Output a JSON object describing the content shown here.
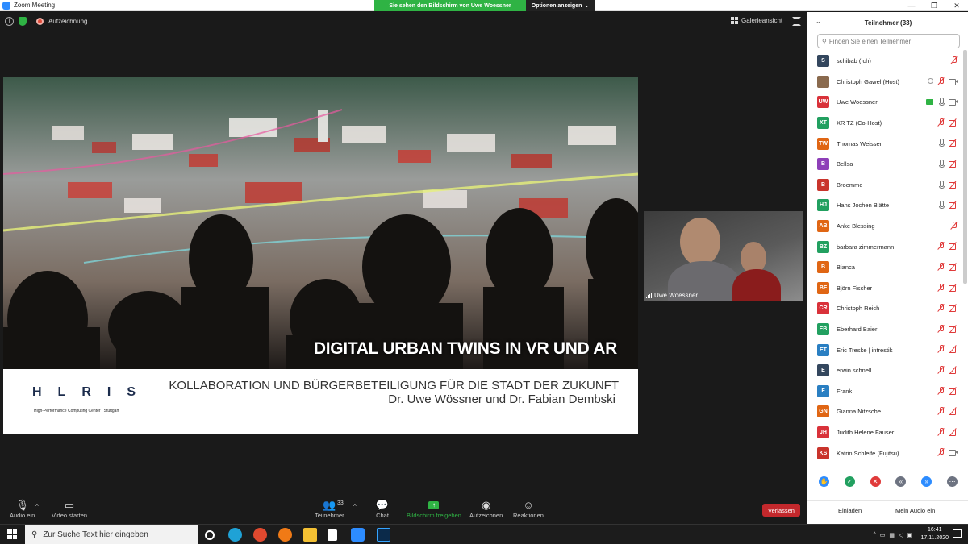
{
  "window": {
    "title": "Zoom Meeting",
    "minimize": "—",
    "maximize": "❐",
    "close": "✕"
  },
  "share_banner": {
    "message": "Sie sehen den Bildschirm von Uwe Woessner",
    "options": "Optionen anzeigen"
  },
  "meeting": {
    "recording_label": "Aufzeichnung",
    "gallery_label": "Galerieansicht"
  },
  "slide": {
    "title": "DIGITAL URBAN TWINS IN VR UND AR",
    "subtitle_line1": "KOLLABORATION UND BÜRGERBETEILIGUNG FÜR DIE STADT DER ZUKUNFT",
    "subtitle_line2": "Dr. Uwe Wössner und Dr. Fabian Dembski",
    "logo": "HLRIS",
    "logo_sub": "High-Performance Computing Center | Stuttgart"
  },
  "video": {
    "name": "Uwe Woessner"
  },
  "toolbar": {
    "audio": "Audio ein",
    "video": "Video starten",
    "participants": "Teilnehmer",
    "participants_count": "33",
    "chat": "Chat",
    "share": "Bildschirm freigeben",
    "record": "Aufzeichnen",
    "reactions": "Reaktionen",
    "leave": "Verlassen"
  },
  "panel": {
    "title": "Teilnehmer (33)",
    "search_placeholder": "Finden Sie einen Teilnehmer",
    "invite": "Einladen",
    "audio": "Mein Audio ein",
    "participants": [
      {
        "initials": "S",
        "name": "schibab (Ich)",
        "color": "#34475e",
        "mic": "off",
        "cam": "none",
        "extra": ""
      },
      {
        "initials": "",
        "name": "Christoph Gawel (Host)",
        "color": "#8a6a4e",
        "mic": "off",
        "cam": "on",
        "extra": "rec"
      },
      {
        "initials": "UW",
        "name": "Uwe Woessner",
        "color": "#d9323a",
        "mic": "on",
        "cam": "on",
        "extra": "share"
      },
      {
        "initials": "XT",
        "name": "XR TZ (Co-Host)",
        "color": "#22a060",
        "mic": "off",
        "cam": "off",
        "extra": ""
      },
      {
        "initials": "TW",
        "name": "Thomas Weisser",
        "color": "#e06614",
        "mic": "on",
        "cam": "off",
        "extra": ""
      },
      {
        "initials": "B",
        "name": "Bellsa",
        "color": "#8e3fb8",
        "mic": "on",
        "cam": "off",
        "extra": ""
      },
      {
        "initials": "B",
        "name": "Broemme",
        "color": "#c9342c",
        "mic": "on",
        "cam": "off",
        "extra": ""
      },
      {
        "initials": "HJ",
        "name": "Hans Jochen Blätte",
        "color": "#22a060",
        "mic": "on",
        "cam": "off",
        "extra": ""
      },
      {
        "initials": "AB",
        "name": "Anke Blessing",
        "color": "#e06614",
        "mic": "off",
        "cam": "none",
        "extra": ""
      },
      {
        "initials": "BZ",
        "name": "barbara zimmermann",
        "color": "#22a060",
        "mic": "off",
        "cam": "off",
        "extra": ""
      },
      {
        "initials": "B",
        "name": "Bianca",
        "color": "#e06614",
        "mic": "off",
        "cam": "off",
        "extra": ""
      },
      {
        "initials": "BF",
        "name": "Björn Fischer",
        "color": "#e06614",
        "mic": "off",
        "cam": "off",
        "extra": ""
      },
      {
        "initials": "CR",
        "name": "Christoph Reich",
        "color": "#d9323a",
        "mic": "off",
        "cam": "off",
        "extra": ""
      },
      {
        "initials": "EB",
        "name": "Eberhard Baier",
        "color": "#22a060",
        "mic": "off",
        "cam": "off",
        "extra": ""
      },
      {
        "initials": "ET",
        "name": "Eric Treske | intrestik",
        "color": "#2a7fc2",
        "mic": "off",
        "cam": "off",
        "extra": ""
      },
      {
        "initials": "E",
        "name": "erwin.schnell",
        "color": "#34475e",
        "mic": "off",
        "cam": "off",
        "extra": ""
      },
      {
        "initials": "F",
        "name": "Frank",
        "color": "#2a7fc2",
        "mic": "off",
        "cam": "off",
        "extra": ""
      },
      {
        "initials": "GN",
        "name": "Gianna Nitzsche",
        "color": "#e06614",
        "mic": "off",
        "cam": "off",
        "extra": ""
      },
      {
        "initials": "JH",
        "name": "Judith Helene Fauser",
        "color": "#d9323a",
        "mic": "off",
        "cam": "off",
        "extra": ""
      },
      {
        "initials": "KS",
        "name": "Katrin Schleife (Fujitsu)",
        "color": "#c9342c",
        "mic": "off",
        "cam": "on",
        "extra": ""
      }
    ],
    "reactions": [
      {
        "name": "raise-hand",
        "color": "#2d8cff",
        "glyph": "✋"
      },
      {
        "name": "yes",
        "color": "#22a060",
        "glyph": "✓"
      },
      {
        "name": "no",
        "color": "#e03a3a",
        "glyph": "✕"
      },
      {
        "name": "slower",
        "color": "#6d7381",
        "glyph": "«"
      },
      {
        "name": "faster",
        "color": "#2d8cff",
        "glyph": "»"
      },
      {
        "name": "more",
        "color": "#6d7381",
        "glyph": "⋯"
      }
    ]
  },
  "taskbar": {
    "search_placeholder": "Zur Suche Text hier eingeben",
    "time": "16:41",
    "date": "17.11.2020"
  }
}
